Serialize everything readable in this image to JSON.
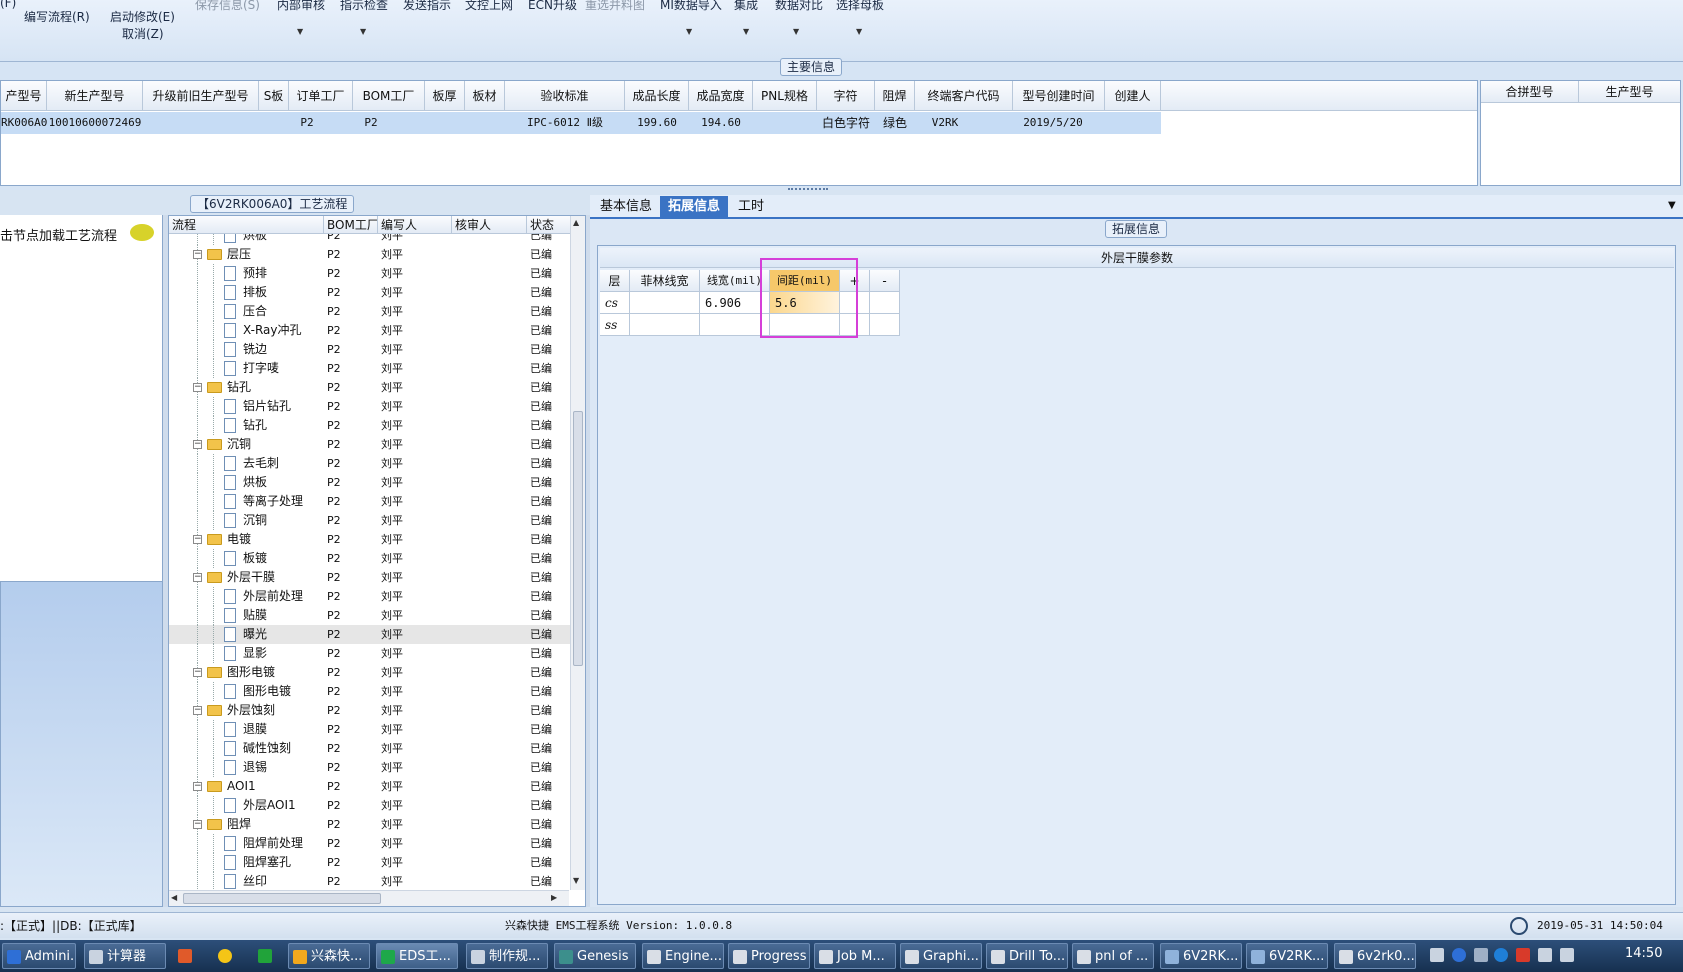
{
  "toolbar": {
    "row1": [
      "(F)",
      "保存信息(S)",
      "内部审核",
      "指示检查",
      "发送指示",
      "文控上网",
      "ECN升级",
      "重选并料图",
      "MI数据导入",
      "集成",
      "数据对比",
      "选择母板"
    ],
    "write_flow": "编写流程(R)",
    "start_modify": "启动修改(E)",
    "cancel": "取消(Z)"
  },
  "main_info": {
    "label": "主要信息",
    "columns": [
      "产型号",
      "新生产型号",
      "升级前旧生产型号",
      "S板",
      "订单工厂",
      "BOM工厂",
      "板厚",
      "板材",
      "验收标准",
      "成品长度",
      "成品宽度",
      "PNL规格",
      "字符",
      "阻焊",
      "终端客户代码",
      "型号创建时间",
      "创建人"
    ],
    "row": [
      "RK006A0",
      "10010600072469",
      "",
      "",
      "P2",
      "P2",
      "",
      "",
      "IPC-6012 Ⅱ级",
      "199.60",
      "194.60",
      "",
      "白色字符",
      "绿色",
      "V2RK",
      "2019/5/20",
      ""
    ],
    "side_columns": [
      "合拼型号",
      "生产型号"
    ]
  },
  "left_panel": {
    "hint": "击节点加载工艺流程"
  },
  "process": {
    "label": "【6V2RK006A0】工艺流程",
    "columns": [
      "流程",
      "BOM工厂",
      "编写人",
      "核审人",
      "状态"
    ],
    "rows": [
      {
        "name": "烘板",
        "type": "doc",
        "factory": "P2",
        "writer": "刘平",
        "status": "已编"
      },
      {
        "name": "层压",
        "type": "folder",
        "factory": "P2",
        "writer": "刘平",
        "status": "已编"
      },
      {
        "name": "预排",
        "type": "doc",
        "factory": "P2",
        "writer": "刘平",
        "status": "已编"
      },
      {
        "name": "排板",
        "type": "doc",
        "factory": "P2",
        "writer": "刘平",
        "status": "已编"
      },
      {
        "name": "压合",
        "type": "doc",
        "factory": "P2",
        "writer": "刘平",
        "status": "已编"
      },
      {
        "name": "X-Ray冲孔",
        "type": "doc",
        "factory": "P2",
        "writer": "刘平",
        "status": "已编"
      },
      {
        "name": "铣边",
        "type": "doc",
        "factory": "P2",
        "writer": "刘平",
        "status": "已编"
      },
      {
        "name": "打字唛",
        "type": "doc",
        "factory": "P2",
        "writer": "刘平",
        "status": "已编"
      },
      {
        "name": "钻孔",
        "type": "folder",
        "factory": "P2",
        "writer": "刘平",
        "status": "已编"
      },
      {
        "name": "铝片钻孔",
        "type": "doc",
        "factory": "P2",
        "writer": "刘平",
        "status": "已编"
      },
      {
        "name": "钻孔",
        "type": "doc",
        "factory": "P2",
        "writer": "刘平",
        "status": "已编"
      },
      {
        "name": "沉铜",
        "type": "folder",
        "factory": "P2",
        "writer": "刘平",
        "status": "已编"
      },
      {
        "name": "去毛刺",
        "type": "doc",
        "factory": "P2",
        "writer": "刘平",
        "status": "已编"
      },
      {
        "name": "烘板",
        "type": "doc",
        "factory": "P2",
        "writer": "刘平",
        "status": "已编"
      },
      {
        "name": "等离子处理",
        "type": "doc",
        "factory": "P2",
        "writer": "刘平",
        "status": "已编"
      },
      {
        "name": "沉铜",
        "type": "doc",
        "factory": "P2",
        "writer": "刘平",
        "status": "已编"
      },
      {
        "name": "电镀",
        "type": "folder",
        "factory": "P2",
        "writer": "刘平",
        "status": "已编"
      },
      {
        "name": "板镀",
        "type": "doc",
        "factory": "P2",
        "writer": "刘平",
        "status": "已编"
      },
      {
        "name": "外层干膜",
        "type": "folder",
        "factory": "P2",
        "writer": "刘平",
        "status": "已编"
      },
      {
        "name": "外层前处理",
        "type": "doc",
        "factory": "P2",
        "writer": "刘平",
        "status": "已编"
      },
      {
        "name": "贴膜",
        "type": "doc",
        "factory": "P2",
        "writer": "刘平",
        "status": "已编"
      },
      {
        "name": "曝光",
        "type": "doc",
        "factory": "P2",
        "writer": "刘平",
        "status": "已编",
        "selected": true
      },
      {
        "name": "显影",
        "type": "doc",
        "factory": "P2",
        "writer": "刘平",
        "status": "已编"
      },
      {
        "name": "图形电镀",
        "type": "folder",
        "factory": "P2",
        "writer": "刘平",
        "status": "已编"
      },
      {
        "name": "图形电镀",
        "type": "doc",
        "factory": "P2",
        "writer": "刘平",
        "status": "已编"
      },
      {
        "name": "外层蚀刻",
        "type": "folder",
        "factory": "P2",
        "writer": "刘平",
        "status": "已编"
      },
      {
        "name": "退膜",
        "type": "doc",
        "factory": "P2",
        "writer": "刘平",
        "status": "已编"
      },
      {
        "name": "碱性蚀刻",
        "type": "doc",
        "factory": "P2",
        "writer": "刘平",
        "status": "已编"
      },
      {
        "name": "退锡",
        "type": "doc",
        "factory": "P2",
        "writer": "刘平",
        "status": "已编"
      },
      {
        "name": "AOI1",
        "type": "folder",
        "factory": "P2",
        "writer": "刘平",
        "status": "已编"
      },
      {
        "name": "外层AOI1",
        "type": "doc",
        "factory": "P2",
        "writer": "刘平",
        "status": "已编"
      },
      {
        "name": "阻焊",
        "type": "folder",
        "factory": "P2",
        "writer": "刘平",
        "status": "已编"
      },
      {
        "name": "阻焊前处理",
        "type": "doc",
        "factory": "P2",
        "writer": "刘平",
        "status": "已编"
      },
      {
        "name": "阻焊塞孔",
        "type": "doc",
        "factory": "P2",
        "writer": "刘平",
        "status": "已编"
      },
      {
        "name": "丝印",
        "type": "doc",
        "factory": "P2",
        "writer": "刘平",
        "status": "已编"
      }
    ]
  },
  "tabs": [
    "基本信息",
    "拓展信息",
    "工时"
  ],
  "extension": {
    "label": "拓展信息",
    "title": "外层干膜参数",
    "columns": [
      "层",
      "菲林线宽",
      "线宽(mil)",
      "间距(mil)",
      "+",
      "-"
    ],
    "rows": [
      [
        "cs",
        "",
        "6.906",
        "5.6",
        "",
        ""
      ],
      [
        "ss",
        "",
        "",
        "",
        "",
        ""
      ]
    ]
  },
  "status_bar": {
    "left": ":【正式】||DB:【正式库】",
    "center": "兴森快捷 EMS工程系统 Version: 1.0.0.8",
    "datetime": "2019-05-31 14:50:04"
  },
  "taskbar": {
    "items": [
      "Admini...",
      "计算器",
      "兴森快...",
      "EDS工...",
      "制作规...",
      "Genesis",
      "Engine...",
      "Progress",
      "Job M...",
      "Graphi...",
      "Drill To...",
      "pnl of ...",
      "6V2RK...",
      "6V2RK...",
      "6v2rk0..."
    ],
    "time": "14:50"
  }
}
